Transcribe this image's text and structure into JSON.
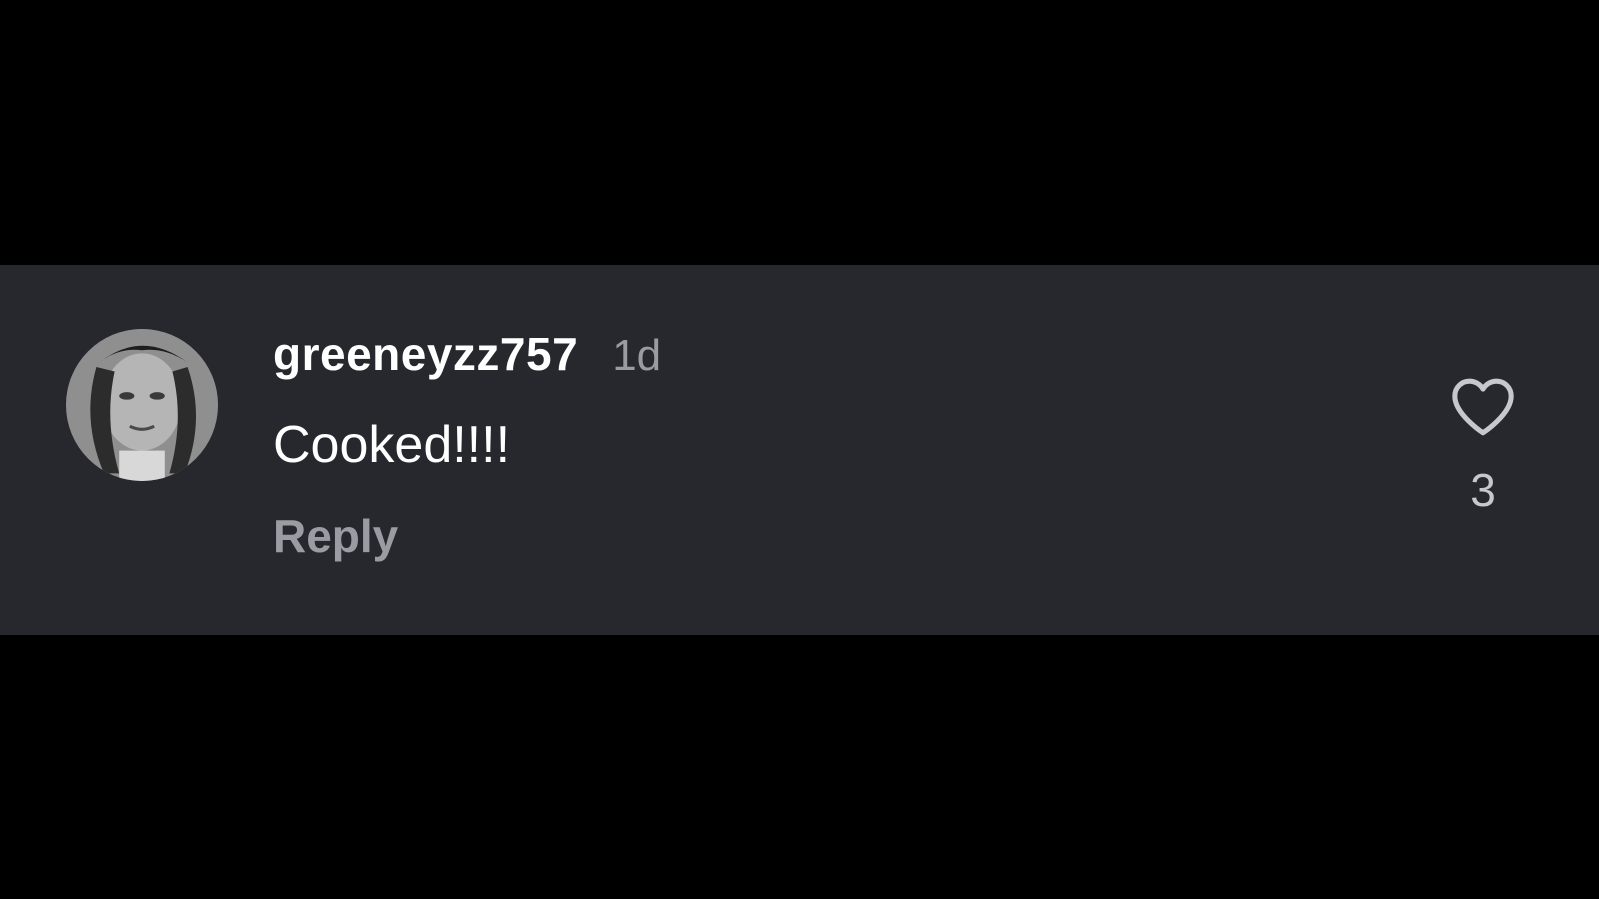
{
  "comment": {
    "username": "greeneyzz757",
    "timestamp": "1d",
    "text": "Cooked!!!!",
    "reply_label": "Reply",
    "like_icon": "heart-outline-icon",
    "like_count": "3"
  },
  "colors": {
    "page_background": "#000000",
    "comment_background": "#26282d",
    "primary_text": "#ffffff",
    "secondary_text": "#9a9ca3"
  }
}
